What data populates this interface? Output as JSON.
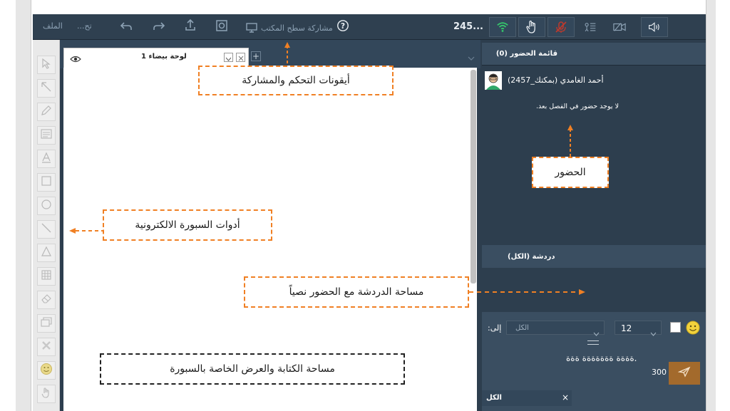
{
  "toolbar": {
    "file_label": "الملف",
    "more_label": "...تح",
    "share_desktop_label": "مشاركة سطح المكتب",
    "count_label": "245..."
  },
  "whiteboard": {
    "tab_label": "لوحة بيضاء 1",
    "add_tab": "+"
  },
  "attendance": {
    "header": "قائمة الحضور (0)",
    "user_name": "(أحمد الغامدي (بمكتك_2457",
    "empty_message": ".لا يوجد حضور في الفصل بعد"
  },
  "chat": {
    "header": "دردشة (الكل)",
    "to_label": "إلى:",
    "recipient_value": "الكل",
    "font_size_value": "12",
    "message_text": "ةةةة ةةةةةةة ةةة.",
    "char_count": "300",
    "bottom_tab_label": "الكل",
    "close_tab": "×"
  },
  "annotations": {
    "controls": "أيقونات التحكم والمشاركة",
    "attendance": "الحضور",
    "tools": "أدوات السبورة الالكترونية",
    "chat": "مساحة الدردشة مع الحضور نصياً",
    "writing": "مساحة الكتابة والعرض الخاصة بالسبورة"
  },
  "colors": {
    "app_bg": "#2d3e4e",
    "accent_orange": "#f08024",
    "wifi_green": "#35c46b",
    "send_button": "#a36a2c"
  },
  "icons": [
    "wifi-icon",
    "hand-icon",
    "mic-off-icon",
    "user-list-icon",
    "camera-icon",
    "speaker-icon",
    "help-icon",
    "upload-icon",
    "undo-icon",
    "redo-icon",
    "eye-icon",
    "smiley-icon",
    "send-icon"
  ]
}
